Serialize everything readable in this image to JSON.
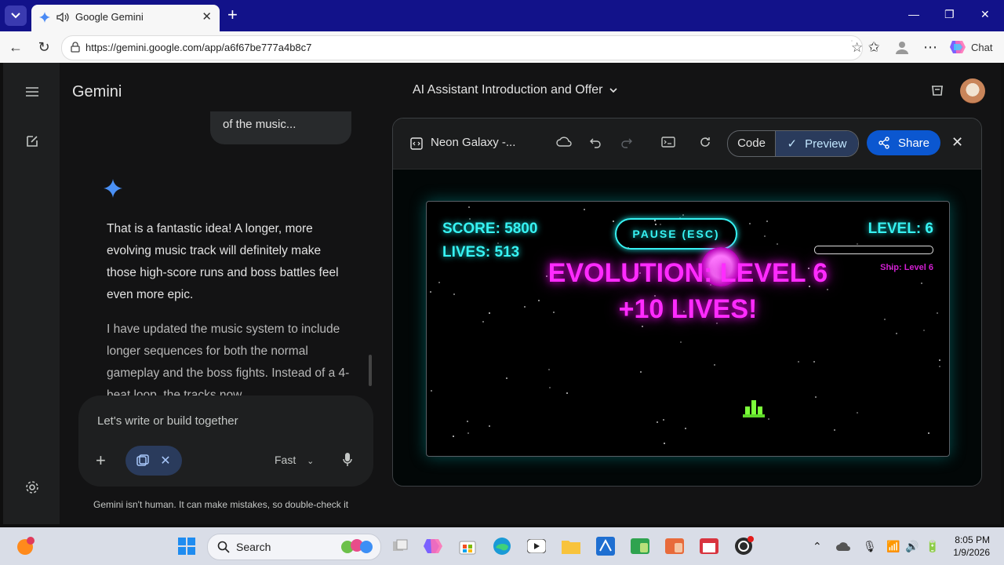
{
  "browser": {
    "tab_title": "Google Gemini",
    "url": "https://gemini.google.com/app/a6f67be777a4b8c7",
    "chat_label": "Chat"
  },
  "app": {
    "brand": "Gemini",
    "conversation_title": "AI Assistant Introduction and Offer"
  },
  "chat": {
    "user_message_tail": "of the music...",
    "reply_paragraphs": [
      "That is a fantastic idea! A longer, more evolving music track will definitely make those high-score runs and boss battles feel even more epic.",
      "I have updated the music system to include longer sequences for both the normal gameplay and the boss fights. Instead of a 4-beat loop, the tracks now"
    ],
    "input_placeholder": "Let's write or build together",
    "mode_label": "Fast",
    "disclaimer": "Gemini isn't human. It can make mistakes, so double-check it"
  },
  "canvas": {
    "doc_title": "Neon Galaxy -...",
    "code_label": "Code",
    "preview_label": "Preview",
    "share_label": "Share"
  },
  "game": {
    "score": "SCORE: 5800",
    "lives": "LIVES: 513",
    "level": "LEVEL: 6",
    "ship_level": "Ship: Level 6",
    "pause": "PAUSE (ESC)",
    "banner_line1": "EVOLUTION: LEVEL 6",
    "banner_line2": "+10 LIVES!",
    "colors": {
      "neon_cyan": "#37f3f3",
      "neon_magenta": "#ff2bff",
      "ship_green": "#7cff3a"
    }
  },
  "taskbar": {
    "search_label": "Search",
    "time": "8:05 PM",
    "date": "1/9/2026"
  }
}
